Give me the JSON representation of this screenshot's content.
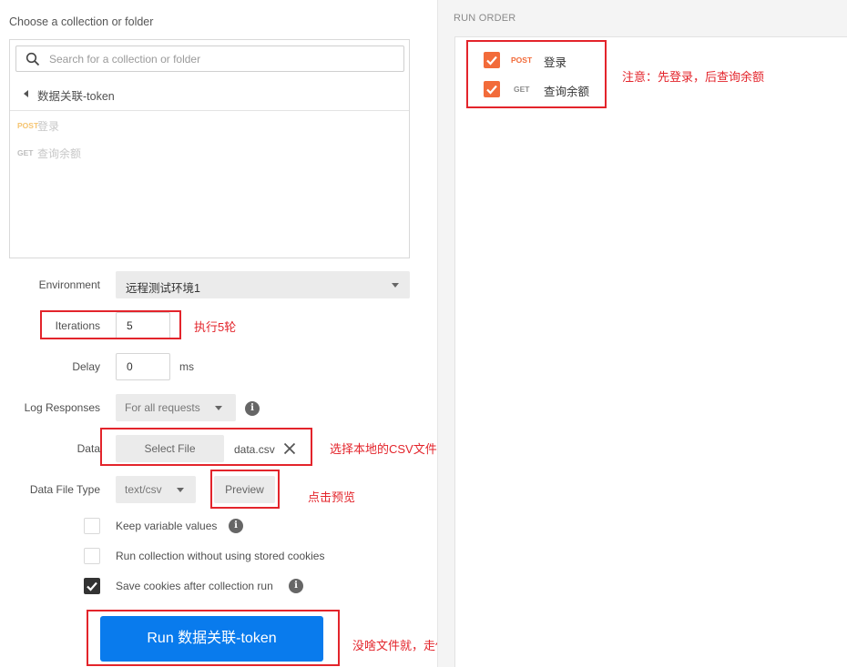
{
  "sidebar": {
    "title": "Choose a collection or folder",
    "search_placeholder": "Search for a collection or folder",
    "breadcrumb": "数据关联-token",
    "requests": [
      {
        "method": "POST",
        "name": "登录"
      },
      {
        "method": "GET",
        "name": "查询余额"
      }
    ]
  },
  "form": {
    "environment_label": "Environment",
    "environment_value": "远程测试环境1",
    "iterations_label": "Iterations",
    "iterations_value": "5",
    "delay_label": "Delay",
    "delay_value": "0",
    "delay_unit": "ms",
    "log_label": "Log Responses",
    "log_value": "For all requests",
    "data_label": "Data",
    "select_file_label": "Select File",
    "file_name": "data.csv",
    "data_file_type_label": "Data File Type",
    "data_file_type_value": "text/csv",
    "preview_label": "Preview",
    "options": [
      {
        "label": "Keep variable values",
        "checked": false,
        "info": true
      },
      {
        "label": "Run collection without using stored cookies",
        "checked": false,
        "info": false
      },
      {
        "label": "Save cookies after collection run",
        "checked": true,
        "info": true
      }
    ],
    "run_button": "Run 数据关联-token"
  },
  "run_order": {
    "title": "RUN ORDER",
    "items": [
      {
        "method": "POST",
        "name": "登录",
        "checked": true
      },
      {
        "method": "GET",
        "name": "查询余额",
        "checked": true
      }
    ]
  },
  "annotations": {
    "iterations_note": "执行5轮",
    "file_note": "选择本地的CSV文件",
    "preview_note": "点击预览",
    "run_note": "没啥文件就，走你.....",
    "order_note": "注意：先登录，后查询余额"
  },
  "colors": {
    "post": "#f5a623",
    "post_orderlist": "#f26b3a",
    "get": "#9b9b9b",
    "run_button": "#097bed",
    "annotation": "#e3242b",
    "check_orange": "#f26b3a"
  },
  "icons": [
    "search-icon",
    "caret-left-icon",
    "chevron-down-icon",
    "info-icon",
    "close-icon",
    "checkmark-icon"
  ]
}
